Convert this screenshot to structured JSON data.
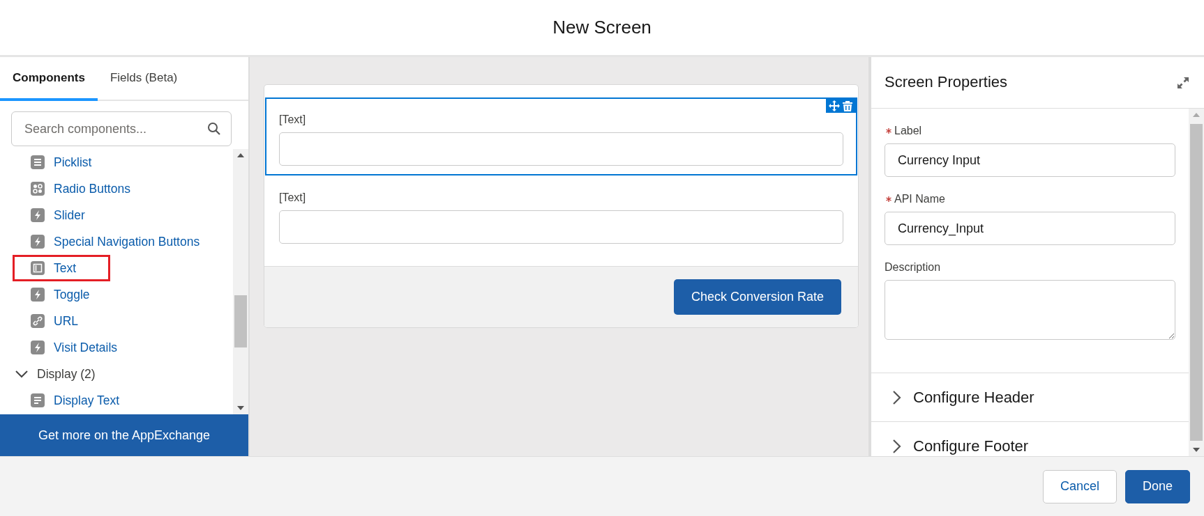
{
  "window": {
    "title": "New Screen"
  },
  "tabs": [
    {
      "label": "Components",
      "selected": true
    },
    {
      "label": "Fields (Beta)",
      "selected": false
    }
  ],
  "search": {
    "placeholder": "Search components..."
  },
  "components": [
    {
      "kind": "list",
      "label": "Picklist",
      "highlighted": false
    },
    {
      "kind": "radio",
      "label": "Radio Buttons",
      "highlighted": false
    },
    {
      "kind": "bolt",
      "label": "Slider",
      "highlighted": false
    },
    {
      "kind": "bolt",
      "label": "Special Navigation Buttons",
      "highlighted": false
    },
    {
      "kind": "text",
      "label": "Text",
      "highlighted": true
    },
    {
      "kind": "bolt",
      "label": "Toggle",
      "highlighted": false
    },
    {
      "kind": "link",
      "label": "URL",
      "highlighted": false
    },
    {
      "kind": "bolt",
      "label": "Visit Details",
      "highlighted": false
    },
    {
      "kind": "group",
      "label": "Display (2)",
      "expanded": true,
      "children": [
        {
          "kind": "display",
          "label": "Display Text",
          "highlighted": false
        }
      ]
    }
  ],
  "appexchange_button": "Get more on the AppExchange",
  "canvas": {
    "fields": [
      {
        "label": "[Text]",
        "selected": true
      },
      {
        "label": "[Text]",
        "selected": false
      }
    ],
    "button": "Check Conversion Rate"
  },
  "properties": {
    "title": "Screen Properties",
    "fields": [
      {
        "kind": "input",
        "label": "Label",
        "required": true,
        "value": "Currency Input"
      },
      {
        "kind": "input",
        "label": "API Name",
        "required": true,
        "value": "Currency_Input"
      },
      {
        "kind": "textarea",
        "label": "Description",
        "required": false
      }
    ],
    "sections": [
      {
        "label": "Configure Header",
        "expanded": false
      },
      {
        "label": "Configure Footer",
        "expanded": false
      }
    ]
  },
  "footer_buttons": [
    {
      "label": "Cancel",
      "kind": "neutral"
    },
    {
      "label": "Done",
      "kind": "brand"
    }
  ]
}
